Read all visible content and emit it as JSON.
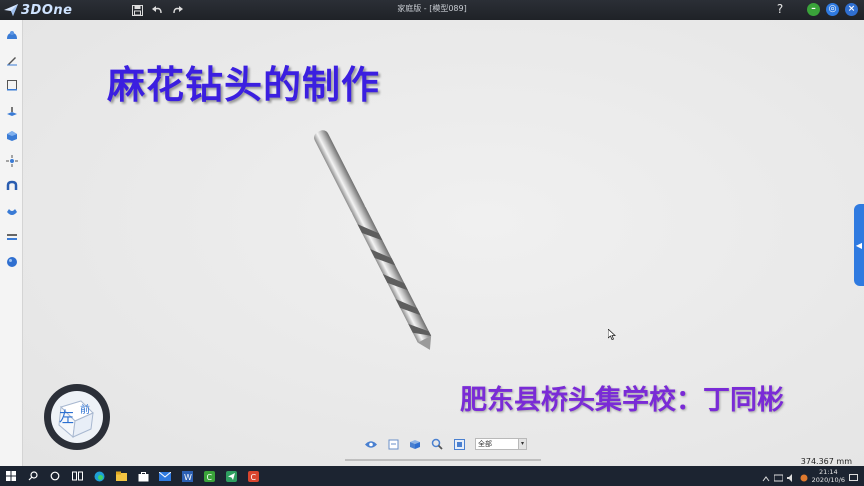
{
  "app": {
    "logo_text": "3DOne",
    "window_title": "家庭版 - [模型089]",
    "help_label": "?"
  },
  "canvas": {
    "heading": "麻花钻头的制作",
    "author_line": "肥东县桥头集学校：丁同彬",
    "viewcube": {
      "left_face": "左",
      "front_face": "前"
    },
    "filter_value": "全部",
    "coordinates": "374.367 mm"
  },
  "taskbar": {
    "time": "21:14",
    "date": "2020/10/6"
  },
  "colors": {
    "heading": "#3b1fe0",
    "author": "#7a2bd6",
    "titlebar": "#1f2227",
    "accent": "#2f7ae0"
  }
}
